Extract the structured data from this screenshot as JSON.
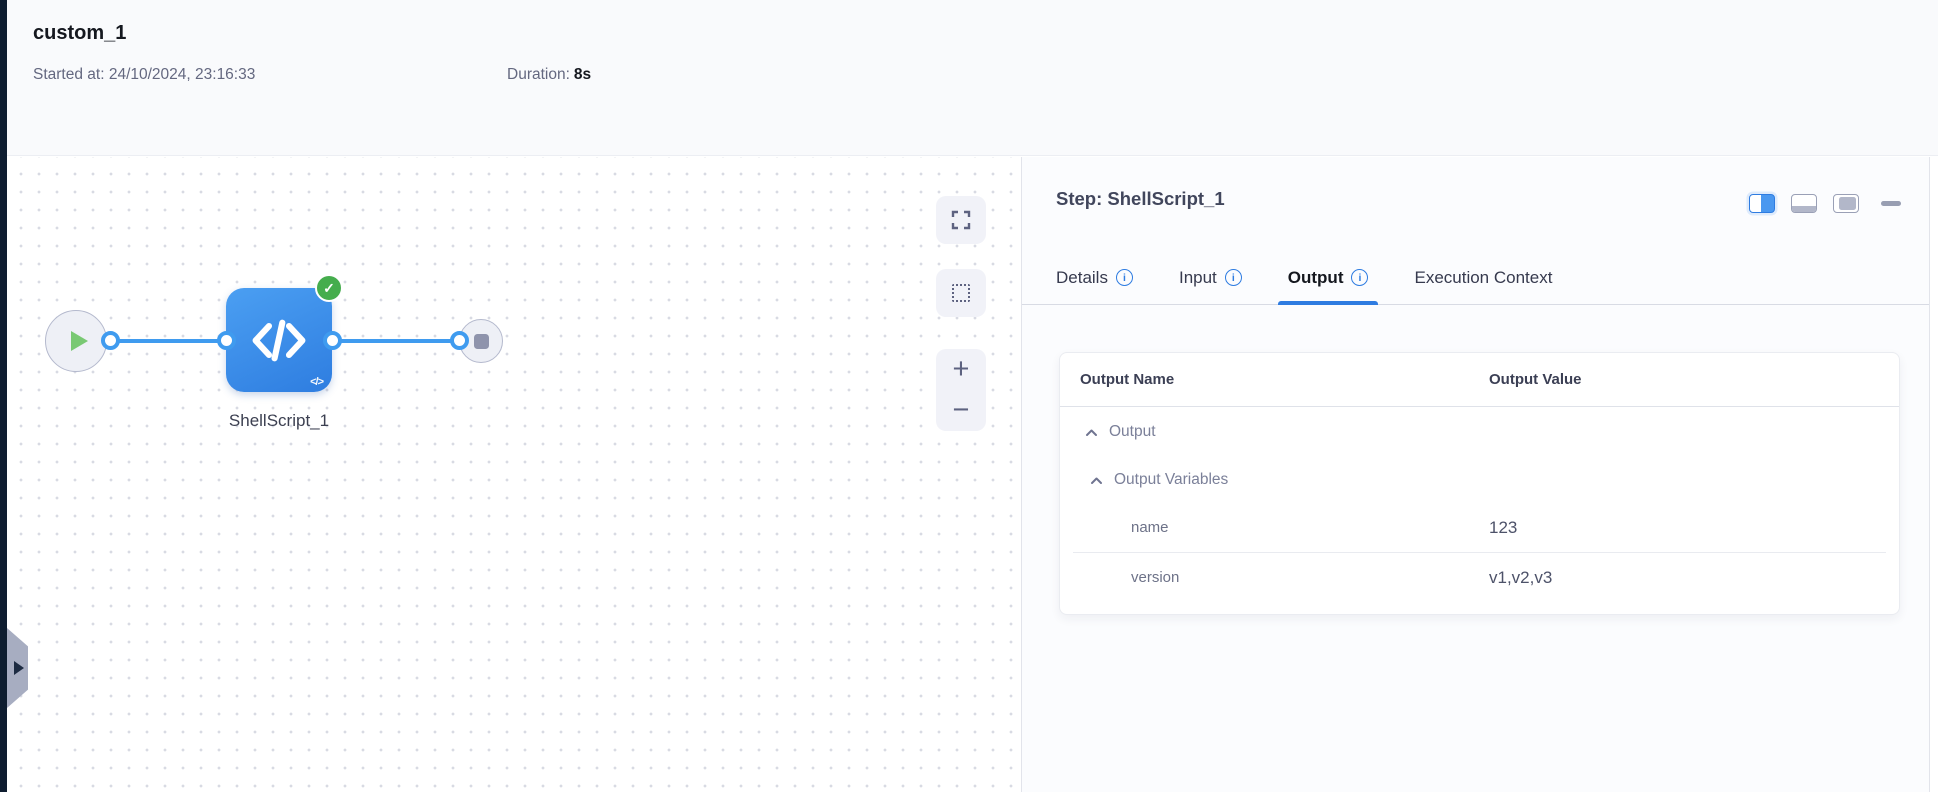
{
  "header": {
    "title": "custom_1",
    "started_label": "Started at:",
    "started_value": "24/10/2024, 23:16:33",
    "duration_label": "Duration:",
    "duration_value": "8s"
  },
  "canvas": {
    "node_label": "ShellScript_1",
    "node_status": "success"
  },
  "icons": {
    "info_glyph": "i",
    "check_glyph": "✓",
    "zoom_in_glyph": "+",
    "zoom_out_glyph": "−",
    "code_small_glyph": "</>"
  },
  "panel": {
    "title": "Step: ShellScript_1",
    "tabs": [
      {
        "label": "Details",
        "has_info": true,
        "active": false
      },
      {
        "label": "Input",
        "has_info": true,
        "active": false
      },
      {
        "label": "Output",
        "has_info": true,
        "active": true
      },
      {
        "label": "Execution Context",
        "has_info": false,
        "active": false
      }
    ],
    "table": {
      "columns": [
        "Output Name",
        "Output Value"
      ],
      "groups": [
        {
          "label": "Output",
          "expanded": true
        },
        {
          "label": "Output Variables",
          "expanded": true
        }
      ],
      "rows": [
        {
          "name": "name",
          "value": "123"
        },
        {
          "name": "version",
          "value": "v1,v2,v3"
        }
      ]
    }
  },
  "colors": {
    "accent_blue": "#2e7ce1",
    "connector_blue": "#3f9bef",
    "node_blue_gradient": [
      "#4b9ff2",
      "#2e7de0"
    ],
    "success_green": "#45ad4d",
    "sidebar_dark": "#0e1d30",
    "panel_bg": "#fbfcfe",
    "header_bg": "#f9fafc"
  }
}
